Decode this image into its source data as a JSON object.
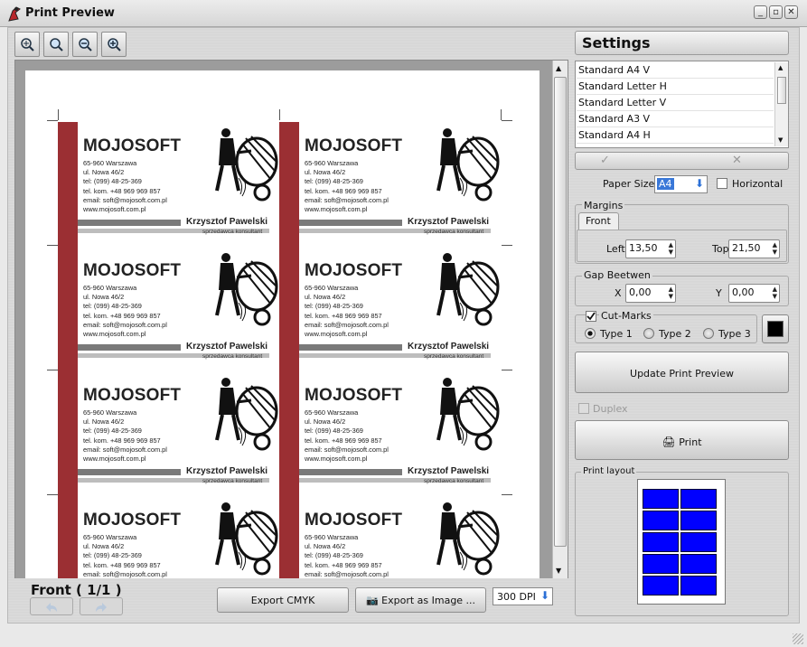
{
  "window": {
    "title": "Print Preview",
    "buttons": [
      "_",
      "▫",
      "✕"
    ]
  },
  "toolbar": {
    "icons": [
      "zoom-fit-icon",
      "zoom-actual-icon",
      "zoom-out-icon",
      "zoom-in-icon"
    ]
  },
  "preview": {
    "card": {
      "company": "MOJOSOFT",
      "address": "65-960 Warszawa\nul. Nowa 46/2\ntel: (099) 48-25-369\ntel. kom. +48 969 969 857\nemail: soft@mojosoft.com.pl\nwww.mojosoft.com.pl",
      "name": "Krzysztof Pawelski",
      "position": "sprzedawca konsultant"
    },
    "stripe_color": "#9b2f33"
  },
  "footer": {
    "page_label": "Front ( 1/1 )",
    "export_cmyk": "Export CMYK",
    "export_image": "Export as Image ...",
    "dpi": "300 DPI"
  },
  "settings": {
    "title": "Settings",
    "sizes": [
      "Standard A4 V",
      "Standard Letter H",
      "Standard Letter V",
      "Standard A3 V",
      "Standard A4 H"
    ],
    "ok_glyph": "✓",
    "cancel_glyph": "✕",
    "paper_size_label": "Paper Size",
    "paper_size_value": "A4",
    "horizontal_label": "Horizontal",
    "margins": {
      "title": "Margins",
      "tab": "Front",
      "left_label": "Left",
      "left_value": "13,50",
      "top_label": "Top",
      "top_value": "21,50"
    },
    "gap": {
      "title": "Gap Beetwen",
      "x_label": "X",
      "x_value": "0,00",
      "y_label": "Y",
      "y_value": "0,00"
    },
    "cutmarks": {
      "label": "Cut-Marks",
      "checked": true,
      "types": [
        "Type 1",
        "Type 2",
        "Type 3"
      ],
      "selected": 0,
      "color": "#000000"
    },
    "update_label": "Update Print Preview",
    "duplex_label": "Duplex",
    "print_label": "Print",
    "layout_title": "Print layout",
    "layout_color": "#0000ff"
  }
}
